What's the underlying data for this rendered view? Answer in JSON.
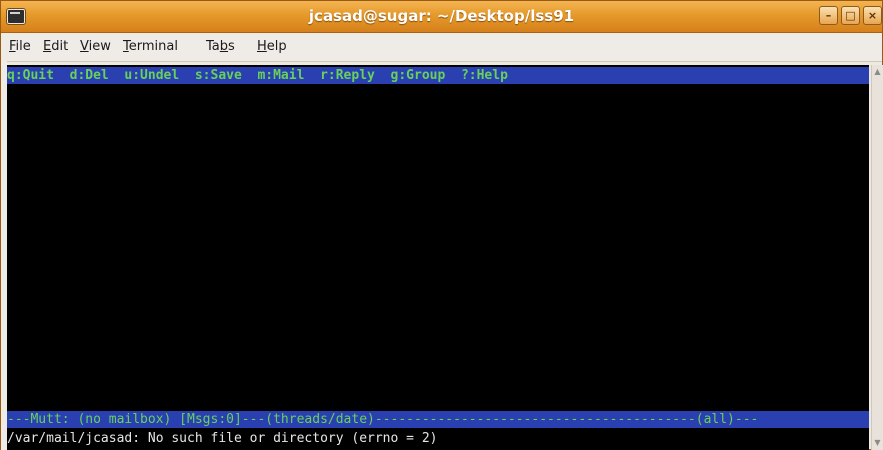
{
  "window": {
    "title": "jcasad@sugar: ~/Desktop/lss91",
    "controls": {
      "minimize": "–",
      "maximize": "□",
      "close": "×"
    }
  },
  "menubar": {
    "items": [
      {
        "pre": "",
        "acc": "F",
        "post": "ile"
      },
      {
        "pre": "",
        "acc": "E",
        "post": "dit"
      },
      {
        "pre": "",
        "acc": "V",
        "post": "iew"
      },
      {
        "pre": "",
        "acc": "T",
        "post": "erminal"
      },
      {
        "pre": "Ta",
        "acc": "b",
        "post": "s"
      },
      {
        "pre": "",
        "acc": "H",
        "post": "elp"
      }
    ]
  },
  "terminal": {
    "help_bar": "q:Quit  d:Del  u:Undel  s:Save  m:Mail  r:Reply  g:Group  ?:Help",
    "status_bar": "---Mutt: (no mailbox) [Msgs:0]---(threads/date)-----------------------------------------(all)---",
    "error_line": "/var/mail/jcasad: No such file or directory (errno = 2)"
  },
  "colors": {
    "titlebar": "#e59a2a",
    "terminal_bg": "#000000",
    "bar_bg": "#2a3fb0",
    "bar_fg": "#67d15c"
  },
  "icons": {
    "app": "terminal-icon",
    "scroll_up": "scroll-up-arrow-icon",
    "scroll_down": "scroll-down-arrow-icon"
  }
}
